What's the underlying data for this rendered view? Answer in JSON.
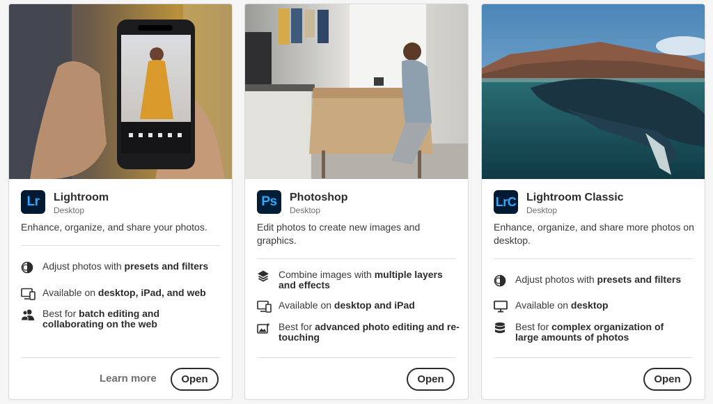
{
  "cards": [
    {
      "icon_text": "Lr",
      "icon": "lightroom-logo-icon",
      "name": "Lightroom",
      "platform": "Desktop",
      "description": "Enhance, organize, and share your photos.",
      "features": [
        {
          "icon": "presets-filters-icon",
          "plain": "Adjust photos with ",
          "bold": "presets and filters"
        },
        {
          "icon": "devices-icon",
          "plain": "Available on ",
          "bold": "desktop, iPad, and web"
        },
        {
          "icon": "users-icon",
          "plain": "Best for ",
          "bold": "batch editing and collaborating on the web"
        }
      ],
      "learn_more": "Learn more",
      "open": "Open"
    },
    {
      "icon_text": "Ps",
      "icon": "photoshop-logo-icon",
      "name": "Photoshop",
      "platform": "Desktop",
      "description": "Edit photos to create new images and graphics.",
      "features": [
        {
          "icon": "layers-icon",
          "plain": "Combine images with ",
          "bold": "multiple layers and effects"
        },
        {
          "icon": "devices-icon",
          "plain": "Available on ",
          "bold": "desktop and iPad"
        },
        {
          "icon": "image-edit-icon",
          "plain": "Best for ",
          "bold": "advanced photo editing and re-touching"
        }
      ],
      "open": "Open"
    },
    {
      "icon_text": "LrC",
      "icon": "lightroom-classic-logo-icon",
      "name": "Lightroom Classic",
      "platform": "Desktop",
      "description": "Enhance, organize, and share more photos on desktop.",
      "features": [
        {
          "icon": "presets-filters-icon",
          "plain": "Adjust photos with ",
          "bold": "presets and filters"
        },
        {
          "icon": "monitor-icon",
          "plain": "Available on ",
          "bold": "desktop"
        },
        {
          "icon": "database-icon",
          "plain": "Best for ",
          "bold": "complex organization of large amounts of photos"
        }
      ],
      "open": "Open"
    }
  ],
  "colors": {
    "app_icon_bg": "#001e36",
    "app_icon_fg": "#31a8ff",
    "button_border": "#2c2c2c",
    "page_bg": "#f5f5f5"
  }
}
